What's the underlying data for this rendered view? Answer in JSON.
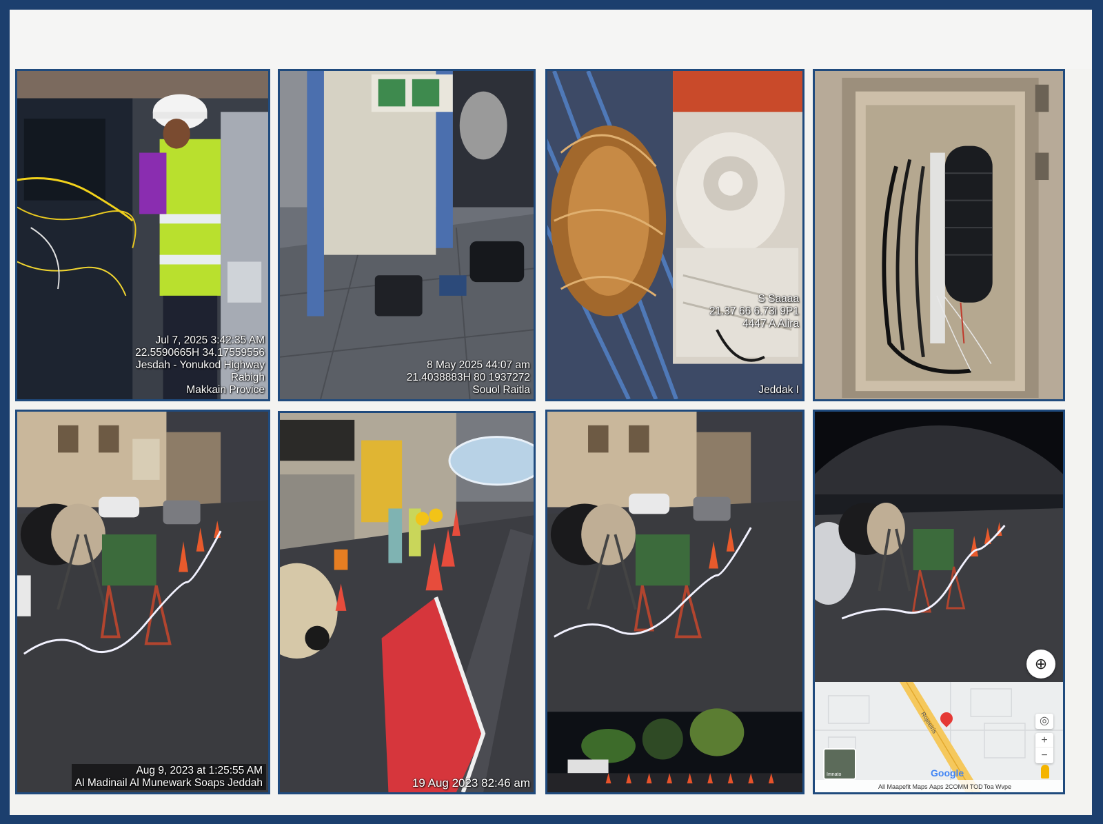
{
  "photos": [
    {
      "id": "photo-1",
      "subject": "Technician in hard hat and hi-vis vest working on a fiber cabinet",
      "stamp_lines": [
        "Jul 7, 2025 3:42:35 AM",
        "22.5590665H 34.17559556",
        "Jesdah - Yonukod Highway",
        "Rabigh",
        "Makkain Provice"
      ]
    },
    {
      "id": "photo-2",
      "subject": "Opened blue equipment rack with test equipment cases on floor",
      "stamp_lines": [
        "8 May 2025 44:07 am",
        "21.4038883H 80 1937272",
        "Souol Raitla"
      ]
    },
    {
      "id": "photo-3",
      "subject": "Coiled fiber cable and open splice tray",
      "stamp_lines": [
        "S Saaaa",
        "21.37 66 6.73i 9P1",
        "4447 A Alira"
      ],
      "stamp_lines_bottom": [
        "Jeddak I"
      ]
    },
    {
      "id": "photo-4",
      "subject": "Handhole with black fiber splice closure and cables",
      "stamp_lines": []
    },
    {
      "id": "photo-5",
      "subject": "Night street with cable drum, traffic cones and barriers",
      "stamp_lines": [
        "Aug 9, 2023 at 1:25:55 AM",
        "Al Madinail Al Munewark Soaps Jeddah"
      ]
    },
    {
      "id": "photo-6",
      "subject": "Night roadside work with workers and red barrier",
      "stamp_lines": [
        "19 Aug 2023 82:46 am"
      ]
    },
    {
      "id": "photo-7",
      "subject": "Night street with cable drum and cones, inset of roundabout",
      "stamp_lines": []
    },
    {
      "id": "photo-8",
      "subject": "Night cable pulling site with map location panel",
      "stamp_lines": [],
      "map": {
        "road_label": "Rojeeiris",
        "brand": "Google",
        "footer_left": "All Maapefit Maps",
        "footer_mid": "Aaps 2COMM TOD",
        "footer_right": "Toa Wvpe",
        "thumb_label": "Imnato",
        "pin_color": "#e53935",
        "road_color": "#f5c85c"
      }
    }
  ],
  "colors": {
    "frame": "#1c3f6e",
    "tile_border": "#1f4a7d",
    "sheet": "#f3f3f1"
  }
}
